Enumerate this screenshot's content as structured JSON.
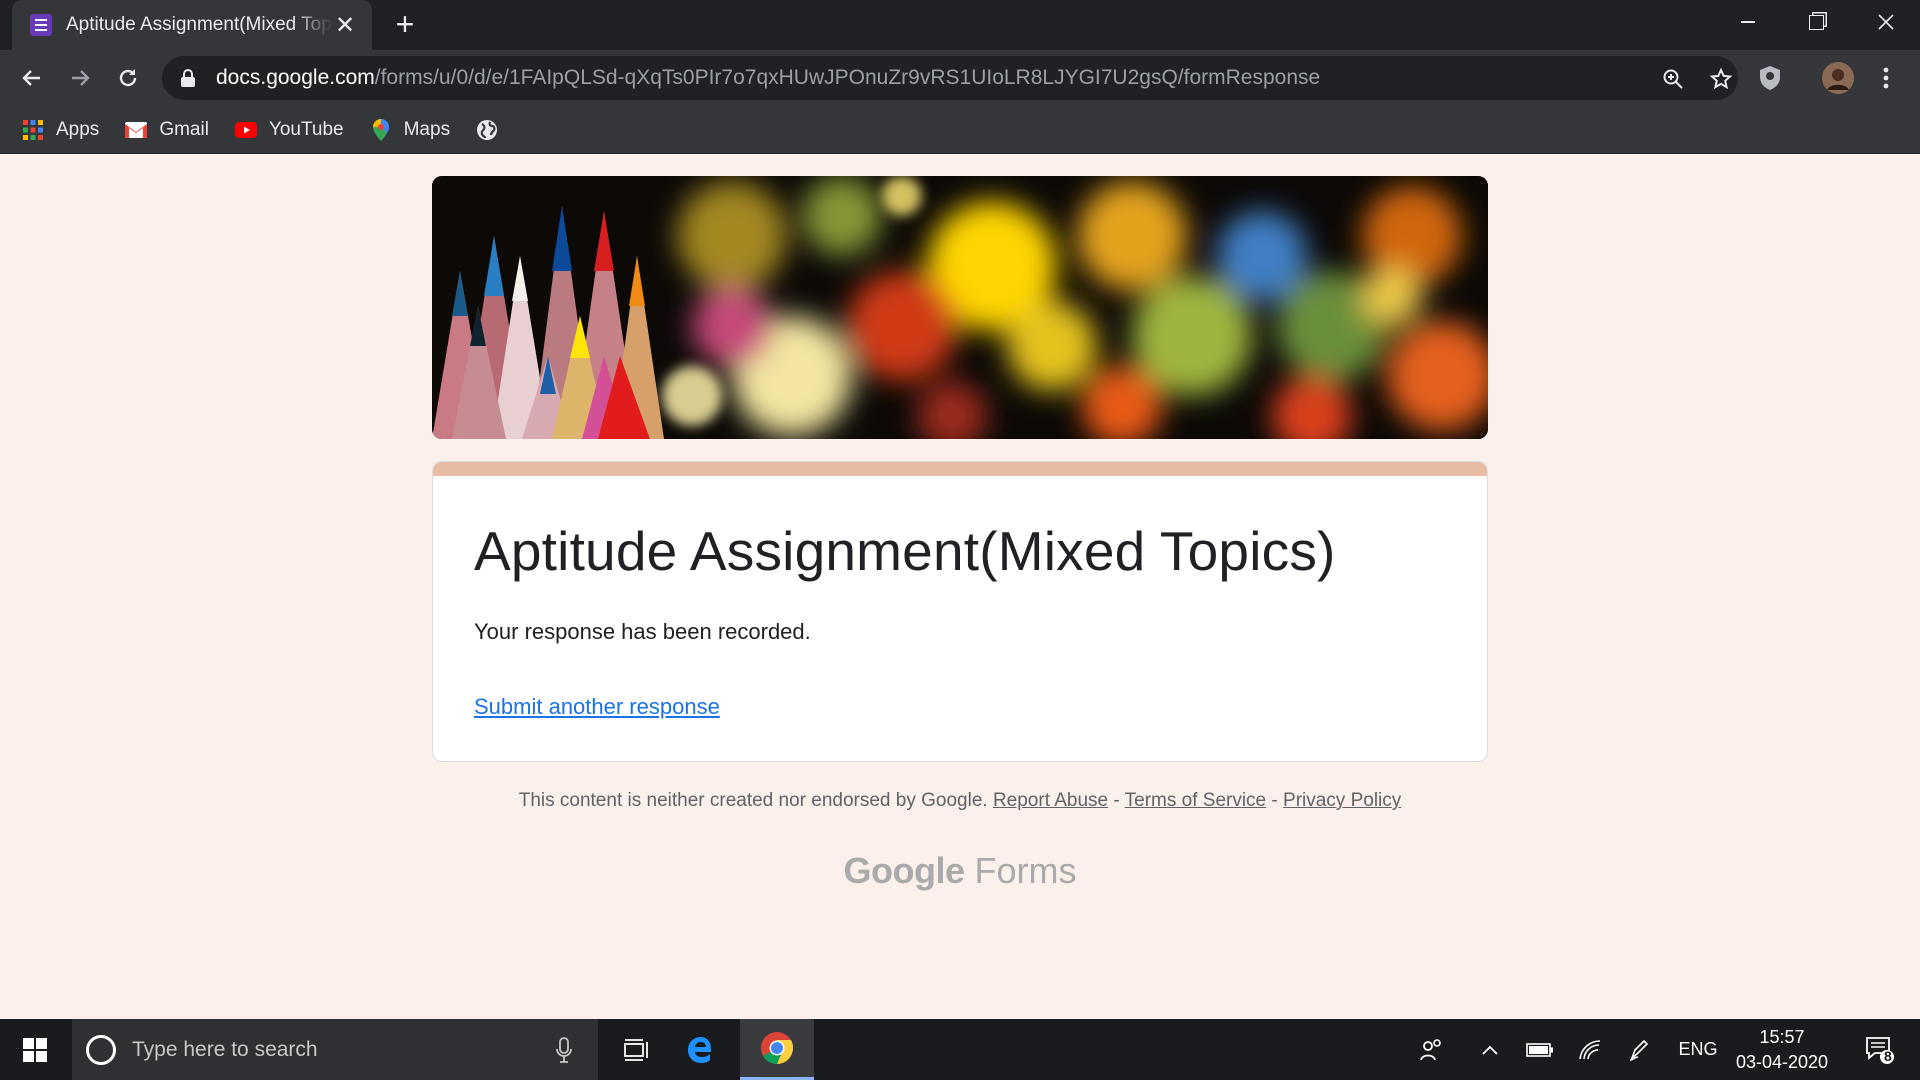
{
  "browser": {
    "tab_title": "Aptitude Assignment(Mixed Topics)",
    "tab_close": "✕",
    "new_tab": "+",
    "url_host": "docs.google.com",
    "url_path": "/forms/u/0/d/e/1FAIpQLSd-qXqTs0PIr7o7qxHUwJPOnuZr9vRS1UIoLR8LJYGI7U2gsQ/formResponse",
    "bookmarks": [
      {
        "label": "Apps",
        "icon": "apps-grid-icon"
      },
      {
        "label": "Gmail",
        "icon": "gmail-icon"
      },
      {
        "label": "YouTube",
        "icon": "youtube-icon"
      },
      {
        "label": "Maps",
        "icon": "maps-pin-icon"
      },
      {
        "label": "",
        "icon": "globe-icon"
      }
    ]
  },
  "form": {
    "title": "Aptitude Assignment(Mixed Topics)",
    "message": "Your response has been recorded.",
    "link": "Submit another response",
    "accent_color": "#e8bba4",
    "link_color": "#1a73e8"
  },
  "footer": {
    "note": "This content is neither created nor endorsed by Google.",
    "report_abuse": "Report Abuse",
    "sep": "-",
    "terms": "Terms of Service",
    "privacy": "Privacy Policy",
    "brand_google": "Google",
    "brand_forms": "Forms"
  },
  "taskbar": {
    "search_placeholder": "Type here to search",
    "language": "ENG",
    "time": "15:57",
    "date": "03-04-2020",
    "notification_count": "8"
  }
}
